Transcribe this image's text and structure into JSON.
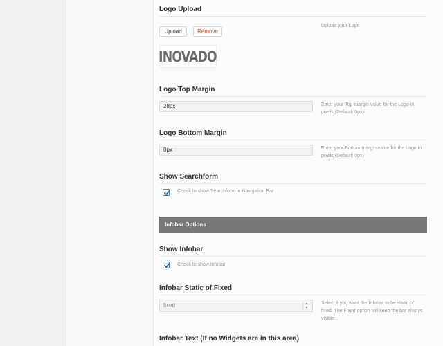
{
  "logo_upload": {
    "title": "Logo Upload",
    "upload_label": "Upload",
    "remove_label": "Remove",
    "description": "Upload your Logo",
    "logo_text": "INOVADO"
  },
  "logo_top_margin": {
    "title": "Logo Top Margin",
    "value": "28px",
    "description": "Enter your Top margin value for the Logo in pixels (Default: 0px)"
  },
  "logo_bottom_margin": {
    "title": "Logo Bottom Margin",
    "value": "0px",
    "description": "Enter your Bottom margin value for the Logo in pixels (Default: 0px)"
  },
  "show_searchform": {
    "title": "Show Searchform",
    "checked": true,
    "label": "Check to show Searchform in Navigation Bar"
  },
  "infobar_options": {
    "title": "Infobar Options"
  },
  "show_infobar": {
    "title": "Show Infobar",
    "checked": true,
    "label": "Check to show Infobar"
  },
  "infobar_static": {
    "title": "Infobar Static of Fixed",
    "selected": "fixed",
    "description": "Select if you want the Infobar to be static of fixed. The Fixed option will keep the bar always visible."
  },
  "infobar_text": {
    "title": "Infobar Text (If no Widgets are in this area)"
  },
  "colors": {
    "group_bar": "#777777",
    "remove": "#d54e21",
    "checkbox": "#4a7fb5"
  }
}
